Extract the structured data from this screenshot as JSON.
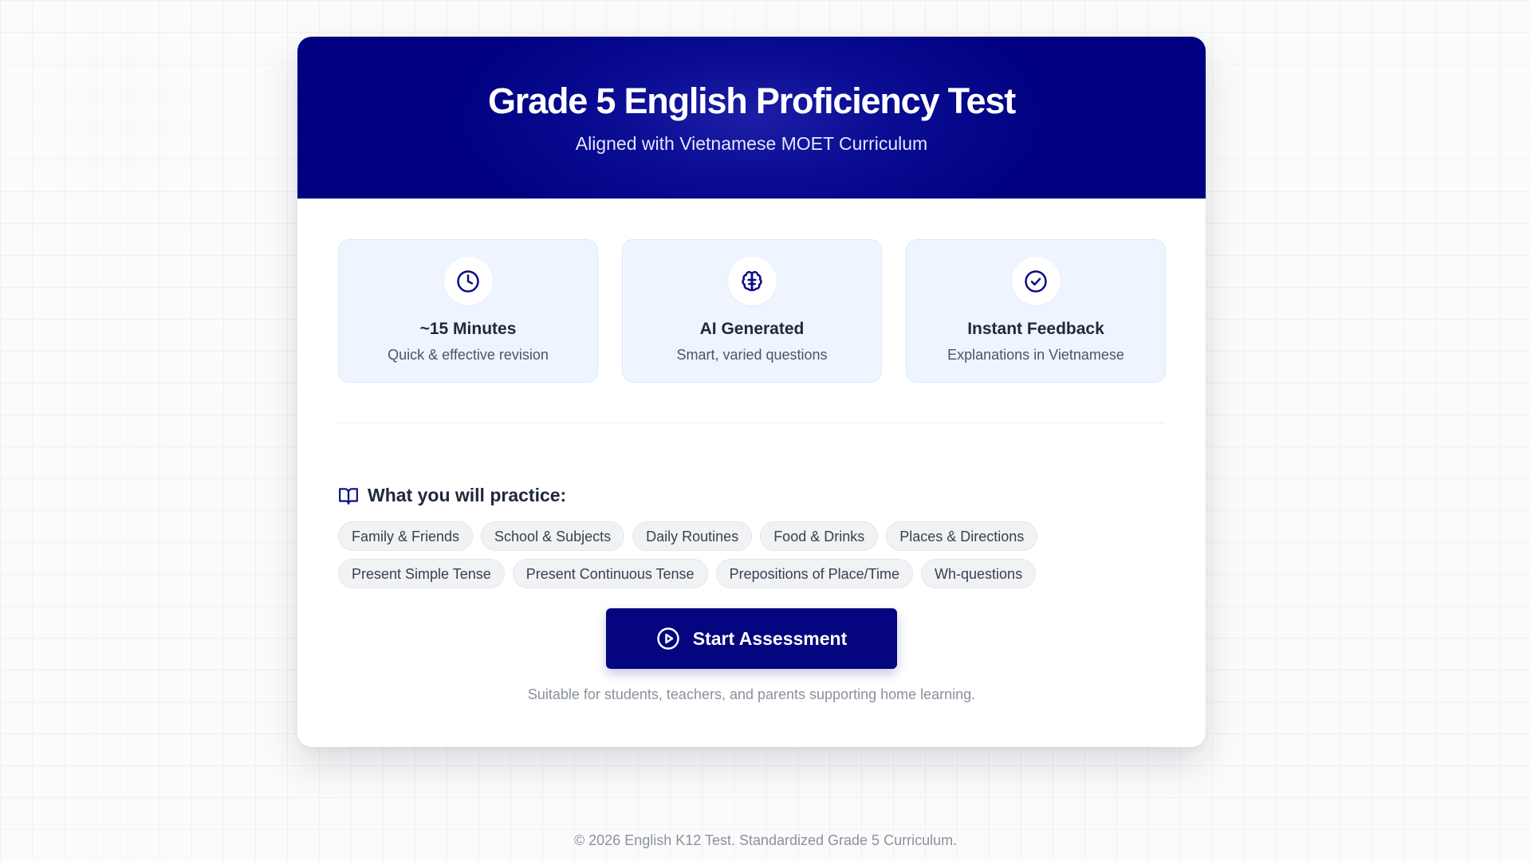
{
  "hero": {
    "title": "Grade 5 English Proficiency Test",
    "subtitle": "Aligned with Vietnamese MOET Curriculum"
  },
  "features": [
    {
      "icon": "clock-icon",
      "title": "~15 Minutes",
      "desc": "Quick & effective revision"
    },
    {
      "icon": "brain-icon",
      "title": "AI Generated",
      "desc": "Smart, varied questions"
    },
    {
      "icon": "check-circle-icon",
      "title": "Instant Feedback",
      "desc": "Explanations in Vietnamese"
    }
  ],
  "practice": {
    "icon": "book-open-icon",
    "title": "What you will practice:",
    "topics": [
      "Family & Friends",
      "School & Subjects",
      "Daily Routines",
      "Food & Drinks",
      "Places & Directions",
      "Present Simple Tense",
      "Present Continuous Tense",
      "Prepositions of Place/Time",
      "Wh-questions"
    ]
  },
  "start": {
    "icon": "play-circle-icon",
    "label": "Start Assessment"
  },
  "caption": "Suitable for students, teachers, and parents supporting home learning.",
  "footer": "© 2026 English K12 Test. Standardized Grade 5 Curriculum.",
  "colors": {
    "brand": "#000080",
    "button": "#04057f",
    "feature_bg": "#eef5ff",
    "tag_bg": "#f1f2f4"
  }
}
